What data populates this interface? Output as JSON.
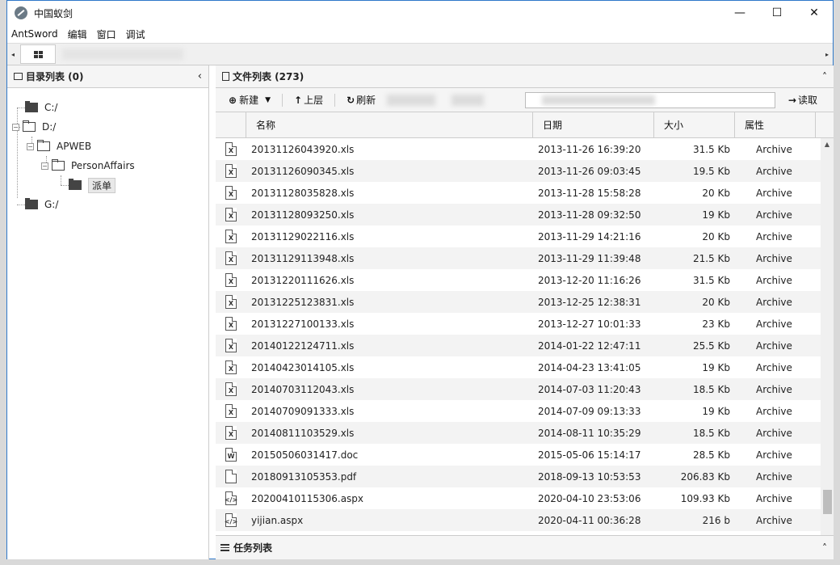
{
  "window": {
    "title": "中国蚁剑",
    "minimize": "—",
    "maximize": "☐",
    "close": "✕"
  },
  "menu": [
    "AntSword",
    "编辑",
    "窗口",
    "调试"
  ],
  "tabs": {
    "left_arrow": "◂",
    "right_arrow": "▸"
  },
  "dir_panel": {
    "title": "目录列表 (0)",
    "collapse": "‹",
    "nodes": {
      "c": "C:/",
      "d": "D:/",
      "apweb": "APWEB",
      "personaffairs": "PersonAffairs",
      "paidan": "派单",
      "g": "G:/"
    }
  },
  "file_panel": {
    "title": "文件列表 (273)",
    "collapse": "˄",
    "toolbar": {
      "new": "新建",
      "up": "上层",
      "refresh": "刷新",
      "read": "读取"
    },
    "columns": {
      "name": "名称",
      "date": "日期",
      "size": "大小",
      "attr": "属性"
    },
    "rows": [
      {
        "icon": "X",
        "name": "20131126043920.xls",
        "date": "2013-11-26 16:39:20",
        "size": "31.5 Kb",
        "attr": "Archive"
      },
      {
        "icon": "X",
        "name": "20131126090345.xls",
        "date": "2013-11-26 09:03:45",
        "size": "19.5 Kb",
        "attr": "Archive"
      },
      {
        "icon": "X",
        "name": "20131128035828.xls",
        "date": "2013-11-28 15:58:28",
        "size": "20 Kb",
        "attr": "Archive"
      },
      {
        "icon": "X",
        "name": "20131128093250.xls",
        "date": "2013-11-28 09:32:50",
        "size": "19 Kb",
        "attr": "Archive"
      },
      {
        "icon": "X",
        "name": "20131129022116.xls",
        "date": "2013-11-29 14:21:16",
        "size": "20 Kb",
        "attr": "Archive"
      },
      {
        "icon": "X",
        "name": "20131129113948.xls",
        "date": "2013-11-29 11:39:48",
        "size": "21.5 Kb",
        "attr": "Archive"
      },
      {
        "icon": "X",
        "name": "20131220111626.xls",
        "date": "2013-12-20 11:16:26",
        "size": "31.5 Kb",
        "attr": "Archive"
      },
      {
        "icon": "X",
        "name": "20131225123831.xls",
        "date": "2013-12-25 12:38:31",
        "size": "20 Kb",
        "attr": "Archive"
      },
      {
        "icon": "X",
        "name": "20131227100133.xls",
        "date": "2013-12-27 10:01:33",
        "size": "23 Kb",
        "attr": "Archive"
      },
      {
        "icon": "X",
        "name": "20140122124711.xls",
        "date": "2014-01-22 12:47:11",
        "size": "25.5 Kb",
        "attr": "Archive"
      },
      {
        "icon": "X",
        "name": "20140423014105.xls",
        "date": "2014-04-23 13:41:05",
        "size": "19 Kb",
        "attr": "Archive"
      },
      {
        "icon": "X",
        "name": "20140703112043.xls",
        "date": "2014-07-03 11:20:43",
        "size": "18.5 Kb",
        "attr": "Archive"
      },
      {
        "icon": "X",
        "name": "20140709091333.xls",
        "date": "2014-07-09 09:13:33",
        "size": "19 Kb",
        "attr": "Archive"
      },
      {
        "icon": "X",
        "name": "20140811103529.xls",
        "date": "2014-08-11 10:35:29",
        "size": "18.5 Kb",
        "attr": "Archive"
      },
      {
        "icon": "W",
        "name": "20150506031417.doc",
        "date": "2015-05-06 15:14:17",
        "size": "28.5 Kb",
        "attr": "Archive"
      },
      {
        "icon": "",
        "name": "20180913105353.pdf",
        "date": "2018-09-13 10:53:53",
        "size": "206.83 Kb",
        "attr": "Archive"
      },
      {
        "icon": "</>",
        "name": "20200410115306.aspx",
        "date": "2020-04-10 23:53:06",
        "size": "109.93 Kb",
        "attr": "Archive"
      },
      {
        "icon": "</>",
        "name": "yijian.aspx",
        "date": "2020-04-11 00:36:28",
        "size": "216 b",
        "attr": "Archive"
      }
    ]
  },
  "task_panel": {
    "title": "任务列表",
    "collapse": "˄"
  }
}
